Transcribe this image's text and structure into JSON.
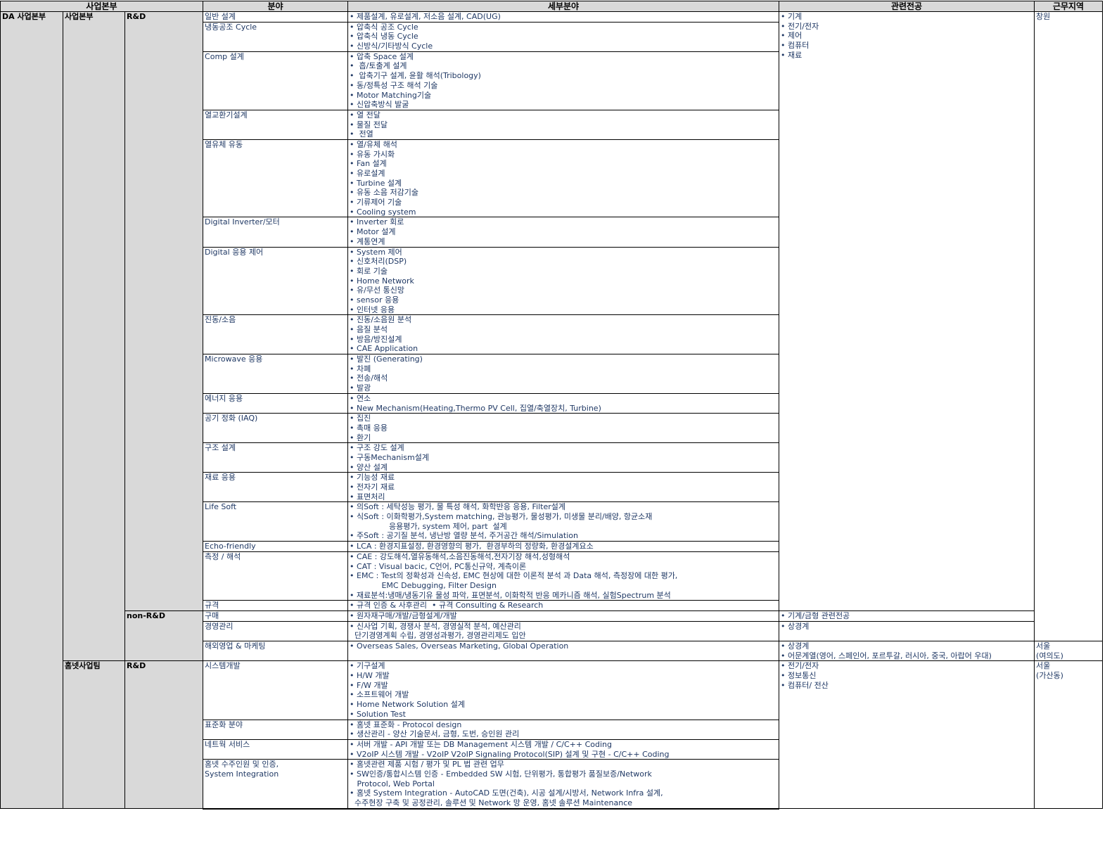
{
  "headers": {
    "division": "사업본부",
    "field": "분야",
    "detail": "세부분야",
    "major": "관련전공",
    "location": "근무지역"
  },
  "division": "DA 사업본부",
  "units": {
    "u1": "사업본부",
    "u2": "홈넷사업팀"
  },
  "types": {
    "rd": "R&D",
    "nonrd": "non-R&D",
    "rd2": "R&D"
  },
  "majors": {
    "m1": [
      "• 기계",
      "• 전기/전자",
      "• 제어",
      "• 컴퓨터",
      "• 재료"
    ],
    "m2": [
      "• 기계/금형 관련전공"
    ],
    "m3": [
      "• 상경계"
    ],
    "m4": [
      "• 상경계",
      "• 어문계열(영어, 스페인어, 포르투갈, 러시아, 중국, 아랍어 우대)"
    ],
    "m5": [
      "• 전기/전자",
      "• 정보통신",
      "• 컴퓨터/ 전산"
    ]
  },
  "locations": {
    "l1": [
      "창원"
    ],
    "l2": [
      "서울",
      "(여의도)"
    ],
    "l3": [
      "서울",
      "(가산동)"
    ]
  },
  "rows": [
    {
      "field": [
        "일반 설계"
      ],
      "detail": [
        "• 제품설계, 유로설계, 저소음 설계, CAD(UG)"
      ]
    },
    {
      "field": [
        "냉동공조 Cycle"
      ],
      "detail": [
        "• 압축식 공조 Cycle",
        "• 압축식 냉동 Cycle",
        "• 신방식/기타방식 Cycle"
      ]
    },
    {
      "field": [
        "Comp 설계"
      ],
      "detail": [
        "• 압축 Space 설계",
        "•  흡/토출계 설계",
        "•  압축기구 설계, 윤활 해석(Tribology)",
        "• 동/정특성 구조 해석 기술",
        "• Motor Matching기술",
        "• 신압축방식 발굴"
      ]
    },
    {
      "field": [
        "열교환기설계"
      ],
      "detail": [
        "• 열 전달",
        "• 물질 전달",
        "•  전열"
      ]
    },
    {
      "field": [
        "열유체 유동"
      ],
      "detail": [
        "• 열/유체 해석",
        "• 유동 가시화",
        "• Fan 설계",
        "• 유로설계",
        "• Turbine 설계",
        "• 유동 소음 저감기술",
        "• 기류제어 기술",
        "• Cooling system"
      ]
    },
    {
      "field": [
        "Digital Inverter/모터"
      ],
      "detail": [
        "• Inverter 회로",
        "• Motor 설계",
        "• 계통연계"
      ]
    },
    {
      "field": [
        "Digital 응용 제어"
      ],
      "detail": [
        "• System 제어",
        "• 신호처리(DSP)",
        "• 회로 기술",
        "• Home Network",
        "• 유/무선 통신망",
        "• sensor 응용",
        "• 인터넷 응용"
      ]
    },
    {
      "field": [
        "진동/소음"
      ],
      "detail": [
        "• 진동/소음원 분석",
        "• 음질 분석",
        "• 방음/방진설계",
        "• CAE Application"
      ]
    },
    {
      "field": [
        "Microwave 응용"
      ],
      "detail": [
        "• 발진 (Generating)",
        "• 차폐",
        "• 전송/해석",
        "• 발광"
      ]
    },
    {
      "field": [
        "에너지 응용"
      ],
      "detail": [
        "• 연소",
        "• New Mechanism(Heating,Thermo PV Cell, 집열/축열장치, Turbine)"
      ]
    },
    {
      "field": [
        "공기 정화 (IAQ)"
      ],
      "detail": [
        "• 집진",
        "• 촉매 응용",
        "• 환기"
      ]
    },
    {
      "field": [
        "구조 설계"
      ],
      "detail": [
        "• 구조 강도 설계",
        "• 구동Mechanism설계",
        "• 양산 설계"
      ]
    },
    {
      "field": [
        "재료 응용"
      ],
      "detail": [
        "• 기능성 재료",
        "• 전자기 재료",
        "• 표면처리"
      ]
    },
    {
      "field": [
        "Life Soft"
      ],
      "detail": [
        "• 의Soft : 세탁성능 평가, 물 특성 해석, 화학반응 응용, Filter설계",
        "• 식Soft : 이화학평가,System matching, 관능평가, 물성평가, 미생물 분리/배양, 항균소재",
        "                응용평가, system 제어, part  설계",
        "• 주Soft : 공기질 분석, 냉난방 열량 분석, 주거공간 해석/Simulation"
      ]
    },
    {
      "field": [
        "Echo-friendly"
      ],
      "detail": [
        "• LCA : 환경지표설정, 환경영향의 평가,  환경부하의 정량화, 환경설계요소"
      ]
    },
    {
      "field": [
        "측정 / 해석"
      ],
      "detail": [
        "• CAE : 강도해석,열유동해석,소음진동해석,전자기장 해석,성형해석",
        "• CAT : Visual bacic, C언어, PC통신규약, 계측이론",
        "• EMC : Test의 정확성과 신속성, EMC 현상에 대한 이론적 분석 과 Data 해석, 측정장에 대한 평가,",
        "             EMC Debugging, Filter Design",
        "• 재료분석:냉매/냉동기유 물성 파악, 표면분석, 이화학적 반응 메카니즘 해석, 실험Spectrum 분석"
      ]
    },
    {
      "field": [
        "규격"
      ],
      "detail": [
        "• 규격 인증 & 사후관리  • 규격 Consulting & Research"
      ]
    },
    {
      "field": [
        "구매"
      ],
      "detail": [
        "• 원자재구매/개발/금형설계/개발"
      ]
    },
    {
      "field": [
        "경영관리"
      ],
      "detail": [
        "• 신사업 기획, 경쟁사 분석, 경영실적 분석, 예산관리",
        "  단기경영계획 수립, 경영성과평가, 경영관리제도 입안"
      ]
    },
    {
      "field": [
        "해외영업 & 마케팅"
      ],
      "detail": [
        "• Overseas Sales, Overseas Marketing, Global Operation"
      ]
    },
    {
      "field": [
        "시스템개발"
      ],
      "detail": [
        "• 기구설계",
        "• H/W 개발",
        "• F/W 개발",
        "• 소프트웨어 개발",
        "• Home Network Solution 설계",
        "• Solution Test"
      ]
    },
    {
      "field": [
        "표준화 분야"
      ],
      "detail": [
        "• 홈넷 표준화 - Protocol design",
        "• 생산관리 - 양산 기술문서, 금형, 도번, 승인원 관리"
      ]
    },
    {
      "field": [
        "네트웍 서비스"
      ],
      "detail": [
        "• 서버 개발 - API 개발 또는 DB Management 시스템 개발 / C/C++ Coding",
        "• V2oIP 시스템 개발 - V2oIP V2oIP Signaling Protocol(SIP) 설계 및 구현 - C/C++ Coding"
      ]
    },
    {
      "field": [
        "홈넷 수주인원 및 인증,",
        "System Integration"
      ],
      "detail": [
        "• 홈넷관련 제품 시험 / 평가 및 PL 법 관련 업무",
        "• SW인증/통합시스템 인증 - Embedded SW 시험, 단위평가, 통합평가 품질보증/Network",
        "   Protocol, Web Portal",
        "• 홈넷 System Integration - AutoCAD 도면(건축), 시공 설계/시방서, Network Infra 설계,",
        "  수주현장 구축 및 공정관리, 솔루션 및 Network 망 운영, 홈넷 솔루션 Maintenance"
      ]
    }
  ]
}
